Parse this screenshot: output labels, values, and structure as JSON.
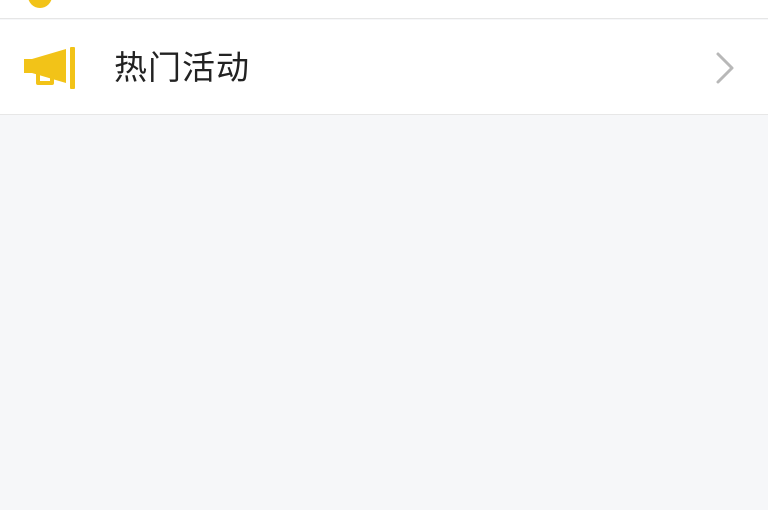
{
  "menu": {
    "items": [
      {
        "label": "热门活动",
        "icon": "megaphone-icon",
        "trailing_icon": "chevron-right-icon"
      }
    ]
  },
  "colors": {
    "accent_yellow": "#F2C318",
    "row_background": "#FFFFFF",
    "page_background": "#F6F7F9",
    "text": "#222222",
    "chevron": "#B8B8B8",
    "divider": "#E7E7E7"
  }
}
